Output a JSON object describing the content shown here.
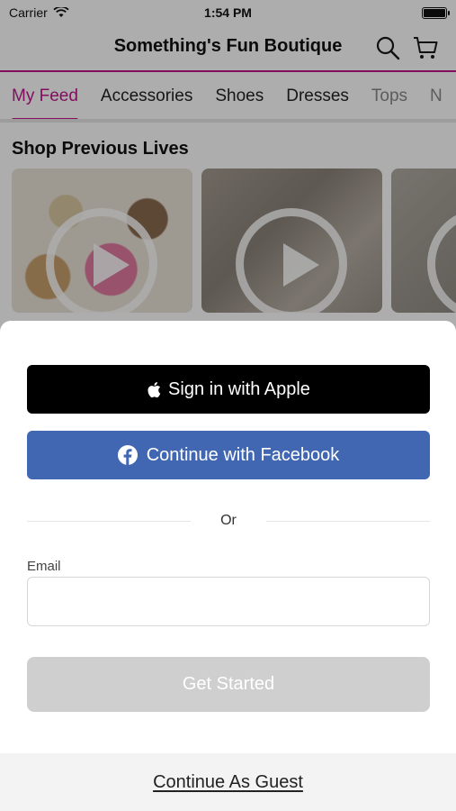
{
  "status_bar": {
    "carrier": "Carrier",
    "time": "1:54 PM"
  },
  "header": {
    "title": "Something's Fun Boutique",
    "icons": [
      "search-icon",
      "cart-icon"
    ]
  },
  "colors": {
    "accent": "#c0168a",
    "facebook": "#4267b2",
    "apple": "#000000",
    "disabled": "#cfcfcf"
  },
  "tabs": [
    {
      "label": "My Feed"
    },
    {
      "label": "Accessories"
    },
    {
      "label": "Shoes"
    },
    {
      "label": "Dresses"
    },
    {
      "label": "Tops"
    },
    {
      "label": "N"
    }
  ],
  "feed": {
    "section_title": "Shop Previous Lives"
  },
  "login": {
    "apple_label": "Sign in with Apple",
    "facebook_label": "Continue with Facebook",
    "or_label": "Or",
    "email_label": "Email",
    "email_value": "",
    "email_placeholder": "",
    "start_label": "Get Started",
    "guest_label": "Continue As Guest"
  }
}
